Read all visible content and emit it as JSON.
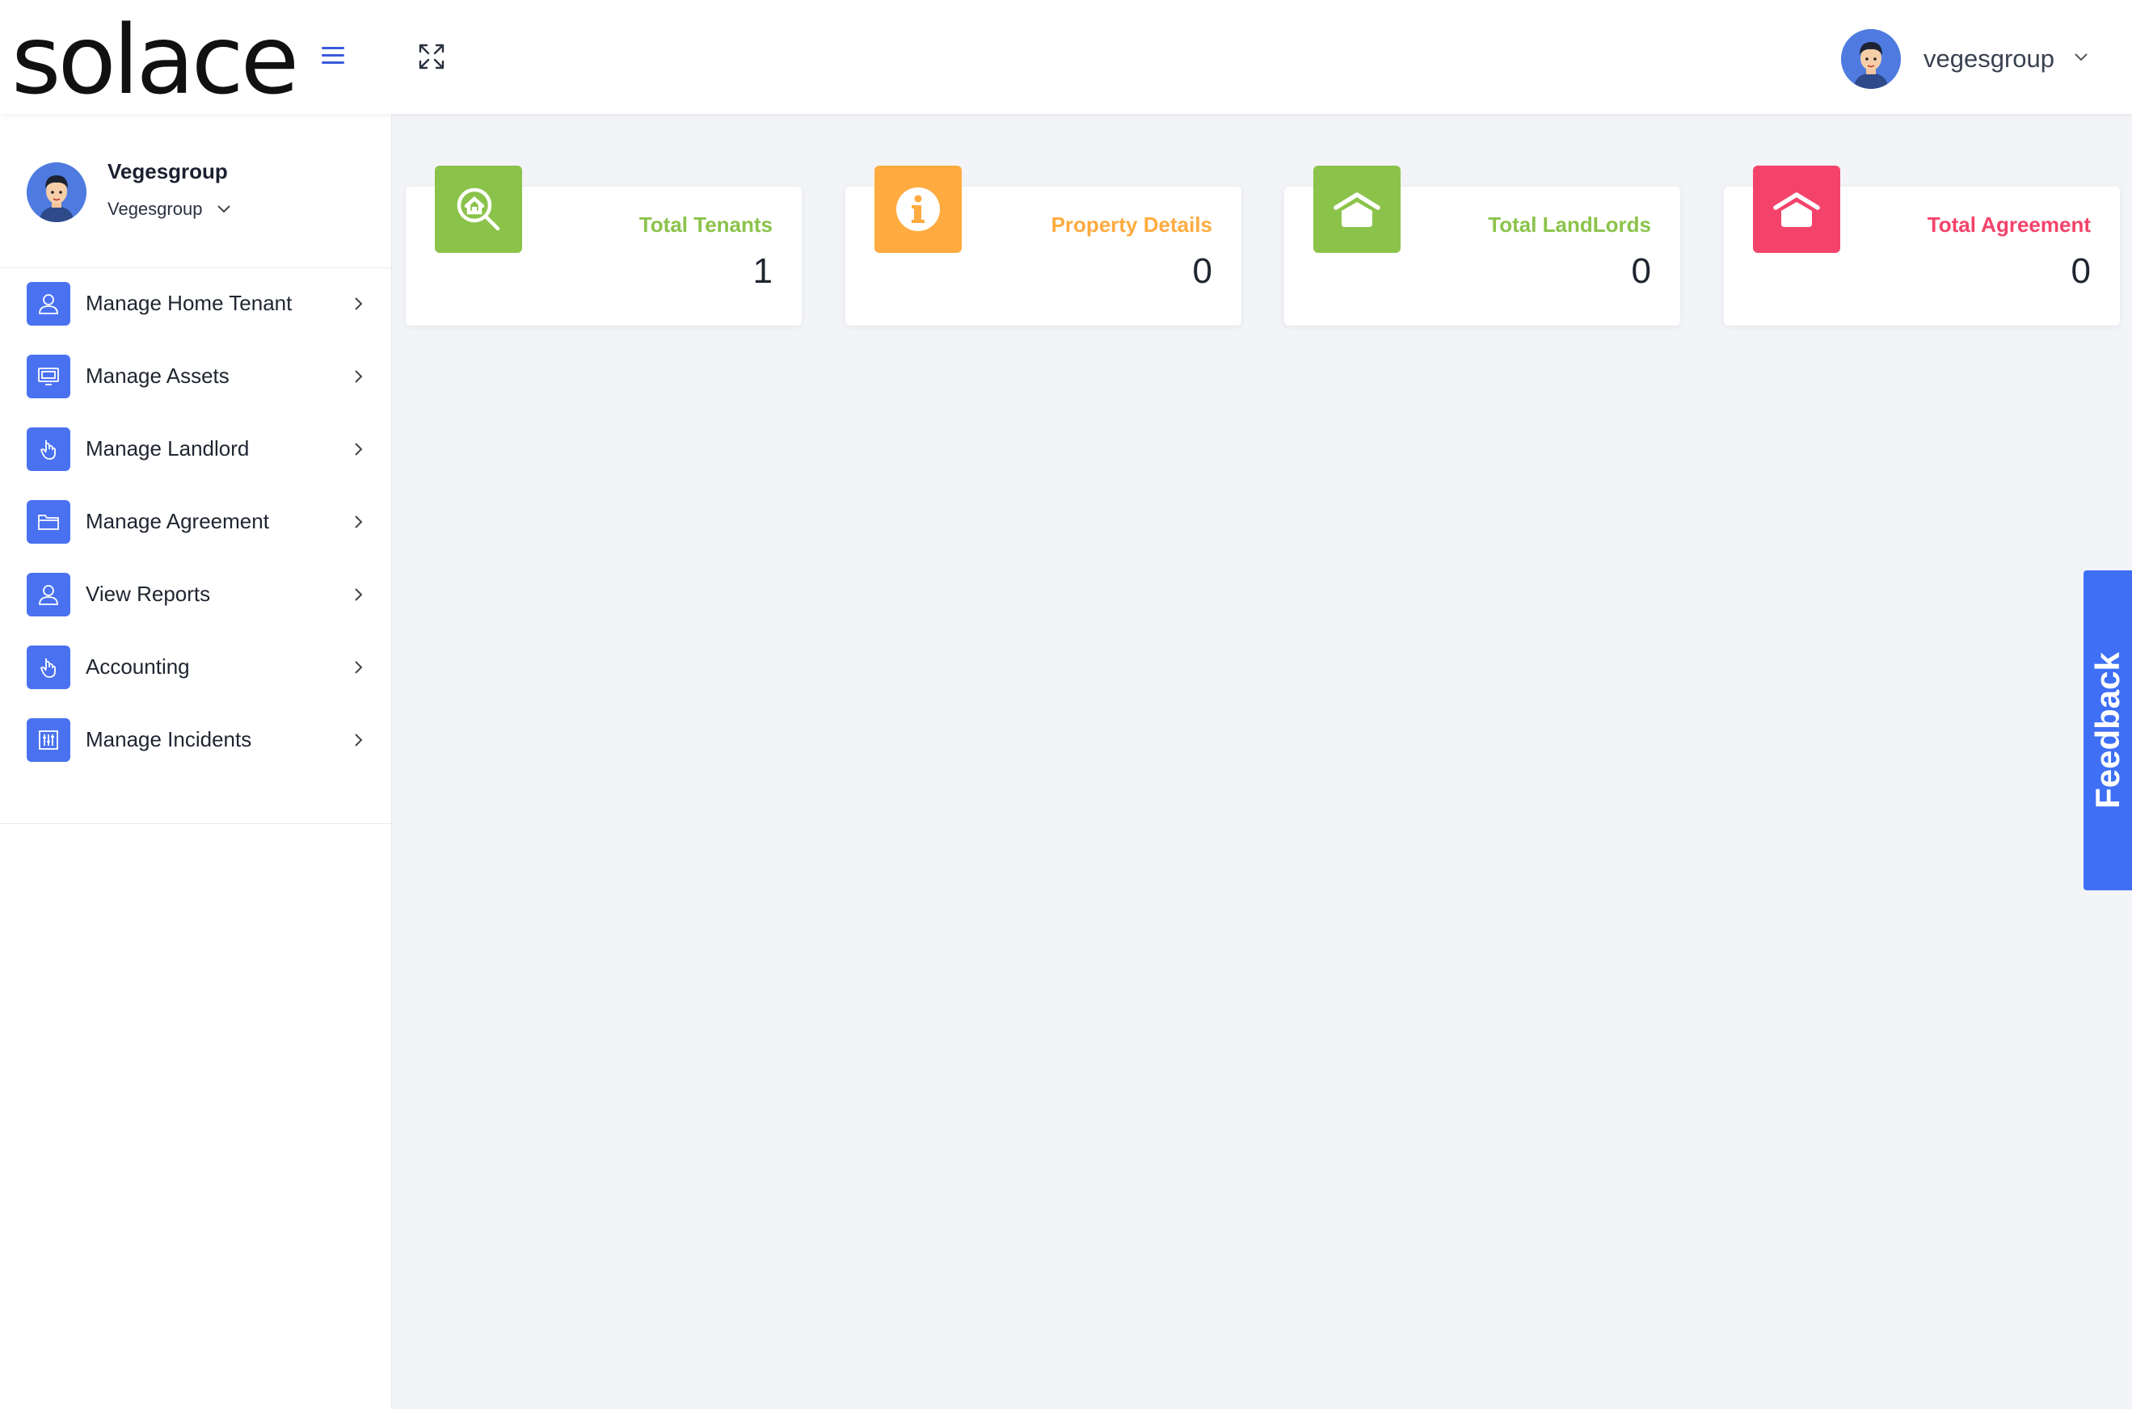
{
  "header": {
    "logo": "solace",
    "username": "vegesgroup"
  },
  "profile": {
    "name": "Vegesgroup",
    "role": "Vegesgroup"
  },
  "sidebar": {
    "items": [
      {
        "label": "Manage Home Tenant",
        "icon": "user-icon"
      },
      {
        "label": "Manage Assets",
        "icon": "monitor-icon"
      },
      {
        "label": "Manage Landlord",
        "icon": "hand-pointer-icon"
      },
      {
        "label": "Manage Agreement",
        "icon": "folder-icon"
      },
      {
        "label": "View Reports",
        "icon": "user-icon"
      },
      {
        "label": "Accounting",
        "icon": "hand-pointer-icon"
      },
      {
        "label": "Manage Incidents",
        "icon": "sliders-icon"
      }
    ]
  },
  "cards": [
    {
      "title": "Total Tenants",
      "value": "1",
      "color": "#8bc34a",
      "icon": "home-search-icon"
    },
    {
      "title": "Property Details",
      "value": "0",
      "color": "#ffab40",
      "icon": "info-icon"
    },
    {
      "title": "Total LandLords",
      "value": "0",
      "color": "#8bc34a",
      "icon": "house-icon"
    },
    {
      "title": "Total Agreement",
      "value": "0",
      "color": "#f4436a",
      "icon": "house-icon"
    }
  ],
  "feedback": {
    "label": "Feedback"
  },
  "colors": {
    "accent": "#4a72f0",
    "background": "#f3f4f8"
  }
}
